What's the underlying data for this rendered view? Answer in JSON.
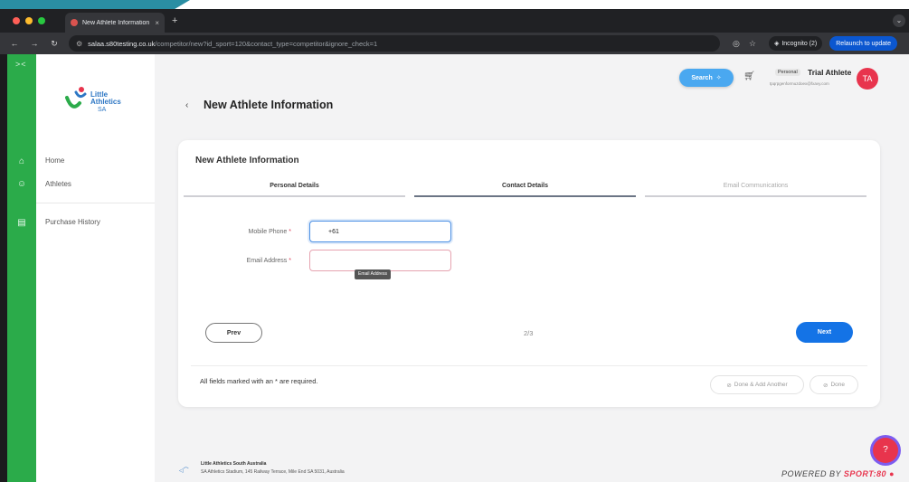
{
  "browser": {
    "tab_title": "New Athlete Information | Litt",
    "tab_close": "×",
    "new_tab": "+",
    "url_main": "salaa.s80testing.co.uk",
    "url_rest": "/competitor/new?id_sport=120&contact_type=competitor&ignore_check=1",
    "incognito_label": "Incognito (2)",
    "relaunch_label": "Relaunch to update",
    "dots": [
      "#ff5f57",
      "#febc2e",
      "#28c840"
    ]
  },
  "sidebar": {
    "collapse_glyph": "><",
    "logo_line1": "Little",
    "logo_line2": "Athletics",
    "logo_line3": "SA",
    "items": [
      {
        "label": "Home",
        "icon": "home-icon"
      },
      {
        "label": "Athletes",
        "icon": "users-icon"
      },
      {
        "label": "Purchase History",
        "icon": "receipt-icon"
      }
    ]
  },
  "header": {
    "back": "‹",
    "title": "New Athlete Information",
    "search_label": "Search",
    "badge": "Personal",
    "user_name": "Trial Athlete",
    "user_email": "tpqrpgenformuzdoex@fxavy.com",
    "avatar_initials": "TA"
  },
  "form": {
    "card_title": "New Athlete Information",
    "steps": [
      "Personal Details",
      "Contact Details",
      "Email Communications"
    ],
    "mobile_label": "Mobile Phone",
    "mobile_value": "+61",
    "email_label": "Email Address",
    "required_mark": "*",
    "tooltip": "Email Address",
    "prev": "Prev",
    "page": "2/3",
    "next": "Next",
    "note": "All fields marked with an * are required.",
    "done_add": "Done & Add Another",
    "done": "Done"
  },
  "footer": {
    "org_name": "Little Athletics South Australia",
    "address": "SA Athletics Stadium, 145 Railway Terrace, Mile End SA 5031, Australia",
    "powered": "POWERED BY",
    "brand": "SPORT:80"
  },
  "colors": {
    "green": "#2bab4a",
    "primary": "#1473e6",
    "accent": "#e8344d"
  }
}
